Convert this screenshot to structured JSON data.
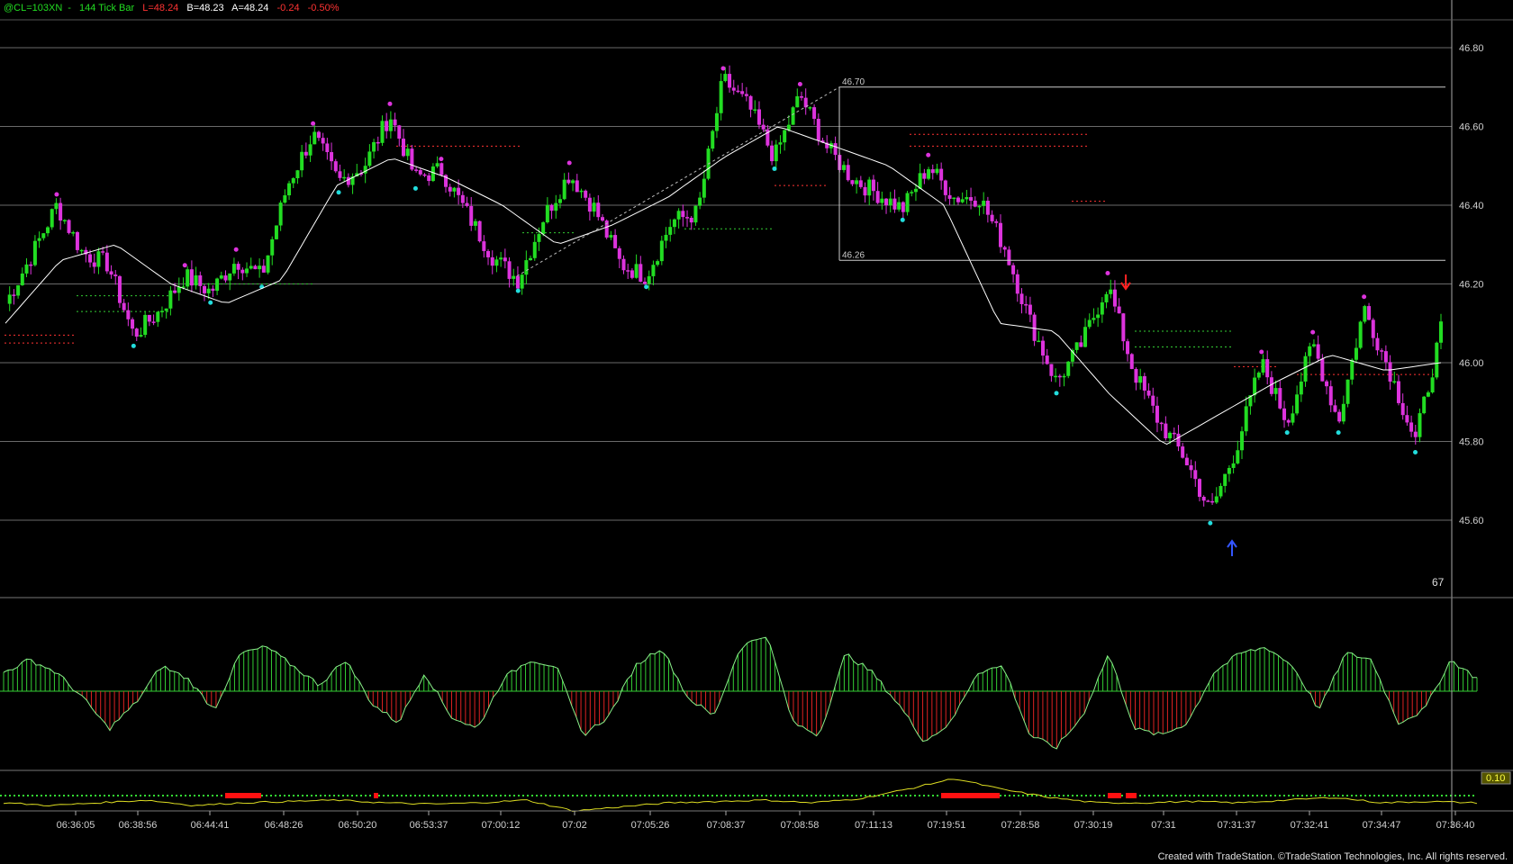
{
  "header": {
    "symbol": "@CL=103XN",
    "bar_type": "144 Tick Bar",
    "low": "L=48.24",
    "bid": "B=48.23",
    "ask": "A=48.24",
    "change": "-0.24",
    "change_pct": "-0.50%"
  },
  "footer": {
    "credit": "Created with TradeStation. ©TradeStation Technologies, Inc. All rights reserved."
  },
  "colors": {
    "up_bar": "#22dd22",
    "down_bar": "#dd33dd",
    "high_dot": "#dd33dd",
    "low_dot": "#22dddd",
    "moving_avg": "#ffffff",
    "osc_pos": "#33cc33",
    "osc_neg": "#dd2222",
    "signal_line": "#dddd22",
    "sell_arrow": "#ff2222",
    "buy_arrow": "#3355ff"
  },
  "chart_data": {
    "type": "candlestick",
    "y_axis": {
      "range": [
        45.6,
        46.8
      ],
      "ticks": [
        "46.80",
        "46.60",
        "46.40",
        "46.20",
        "46.00",
        "45.80",
        "45.60"
      ],
      "grid": true
    },
    "x_axis": {
      "tick_labels": [
        "06:36:05",
        "06:38:56",
        "06:44:41",
        "06:48:26",
        "06:50:20",
        "06:53:37",
        "07:00:12",
        "07:02",
        "07:05:26",
        "07:08:37",
        "07:08:58",
        "07:11:13",
        "07:19:51",
        "07:28:58",
        "07:30:19",
        "07:31",
        "07:31:37",
        "07:32:41",
        "07:34:47",
        "07:36:40"
      ]
    },
    "price_path": [
      46.15,
      46.27,
      46.4,
      46.28,
      46.25,
      46.07,
      46.13,
      46.22,
      46.18,
      46.26,
      46.22,
      46.45,
      46.58,
      46.46,
      46.5,
      46.63,
      46.47,
      46.49,
      46.38,
      46.27,
      46.21,
      46.37,
      46.48,
      46.39,
      46.25,
      46.22,
      46.36,
      46.38,
      46.72,
      46.65,
      46.52,
      46.68,
      46.55,
      46.47,
      46.43,
      46.39,
      46.5,
      46.42,
      46.42,
      46.29,
      46.1,
      45.95,
      46.05,
      46.2,
      45.98,
      45.85,
      45.76,
      45.62,
      45.78,
      46.0,
      45.85,
      46.05,
      45.85,
      46.14,
      45.98,
      45.8,
      46.08
    ],
    "moving_average": [
      46.1,
      46.26,
      46.3,
      46.2,
      46.15,
      46.21,
      46.45,
      46.52,
      46.47,
      46.4,
      46.3,
      46.35,
      46.42,
      46.52,
      46.6,
      46.55,
      46.5,
      46.4,
      46.1,
      46.08,
      45.92,
      45.79,
      45.87,
      45.95,
      46.02,
      45.98,
      46.0
    ],
    "annotations": [
      {
        "label": "46.70",
        "price": 46.7
      },
      {
        "label": "46.26",
        "price": 46.26
      },
      {
        "label": "67"
      }
    ],
    "oscillator": [
      0.3,
      0.5,
      0.3,
      -0.1,
      -0.6,
      -0.2,
      0.4,
      0.2,
      -0.3,
      0.6,
      0.7,
      0.4,
      0.1,
      0.5,
      -0.2,
      -0.5,
      0.3,
      -0.4,
      -0.6,
      0.2,
      0.5,
      0.4,
      -0.7,
      -0.4,
      0.4,
      0.7,
      -0.1,
      -0.4,
      0.7,
      0.9,
      -0.5,
      -0.7,
      0.6,
      0.3,
      -0.2,
      -0.8,
      -0.5,
      0.3,
      0.4,
      -0.7,
      -0.9,
      -0.4,
      0.6,
      -0.6,
      -0.7,
      -0.5,
      0.3,
      0.6,
      0.7,
      0.4,
      -0.3,
      0.6,
      0.5,
      -0.5,
      -0.3,
      0.5,
      0.2
    ],
    "signal_value": "0.10",
    "signal_line": [
      0.0,
      -0.1,
      0.0,
      0.1,
      -0.1,
      0.0,
      0.05,
      0.1,
      0.0,
      -0.05,
      0.0,
      0.1,
      -0.3,
      -0.15,
      0.0,
      0.05,
      0.1,
      0.0,
      0.15,
      0.5,
      0.9,
      0.5,
      0.2,
      0.0,
      0.0,
      0.05,
      0.0,
      0.1,
      0.2,
      0.0,
      0.05,
      0.0
    ]
  }
}
